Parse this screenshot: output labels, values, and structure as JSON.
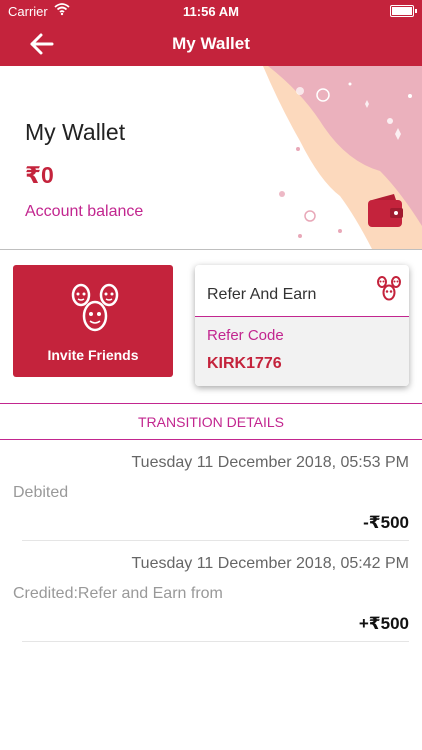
{
  "status_bar": {
    "carrier": "Carrier",
    "time": "11:56 AM"
  },
  "nav": {
    "title": "My Wallet",
    "back_icon": "arrow-left-icon"
  },
  "wallet": {
    "heading": "My Wallet",
    "balance": "₹0",
    "balance_label": "Account balance"
  },
  "invite": {
    "label": "Invite Friends",
    "icon": "friends-faces-icon"
  },
  "refer": {
    "title": "Refer And Earn",
    "code_label": "Refer Code",
    "code": "KIRK1776"
  },
  "section": {
    "title": "TRANSITION DETAILS"
  },
  "transactions": [
    {
      "date": "Tuesday 11 December 2018, 05:53 PM",
      "description": "Debited",
      "amount": "-₹500"
    },
    {
      "date": "Tuesday 11 December 2018, 05:42 PM",
      "description": "Credited:Refer and Earn from",
      "amount": "+₹500"
    }
  ],
  "colors": {
    "primary": "#c4233c",
    "accent": "#c2268f",
    "peach": "#fcd9bd",
    "pink": "#ebb1bd"
  }
}
